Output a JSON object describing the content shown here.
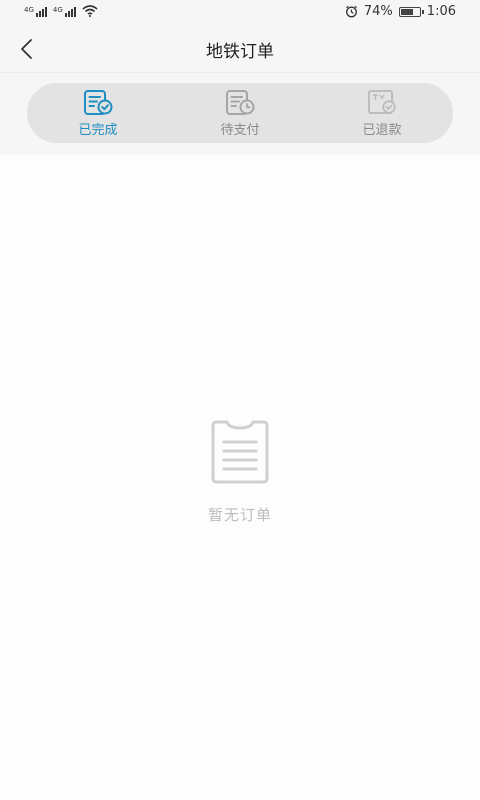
{
  "status_bar": {
    "network_1": "4G",
    "network_2": "4G",
    "battery_percent": "74%",
    "battery_level": 0.74,
    "time": "1:06"
  },
  "nav": {
    "title": "地铁订单",
    "back_icon": "chevron-left-icon"
  },
  "tabs": [
    {
      "label": "已完成",
      "icon": "completed-order-icon",
      "active": true
    },
    {
      "label": "待支付",
      "icon": "pending-payment-icon",
      "active": false
    },
    {
      "label": "已退款",
      "icon": "refunded-icon",
      "active": false
    }
  ],
  "empty_state": {
    "icon": "empty-document-icon",
    "text": "暂无订单"
  },
  "colors": {
    "accent": "#1f8ec2",
    "inactive": "#8a8a8a",
    "empty_text": "#bdbdbd"
  }
}
